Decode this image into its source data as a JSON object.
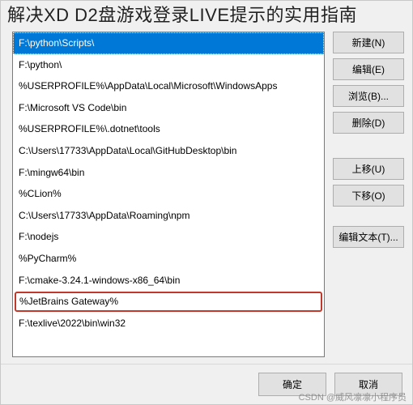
{
  "overlay_title": "解决XD D2盘游戏登录LIVE提示的实用指南",
  "path_list": {
    "selected_index": 0,
    "highlighted_index": 12,
    "items": [
      "F:\\python\\Scripts\\",
      "F:\\python\\",
      "%USERPROFILE%\\AppData\\Local\\Microsoft\\WindowsApps",
      "F:\\Microsoft VS Code\\bin",
      "%USERPROFILE%\\.dotnet\\tools",
      "C:\\Users\\17733\\AppData\\Local\\GitHubDesktop\\bin",
      "F:\\mingw64\\bin",
      "%CLion%",
      "C:\\Users\\17733\\AppData\\Roaming\\npm",
      "F:\\nodejs",
      "%PyCharm%",
      "F:\\cmake-3.24.1-windows-x86_64\\bin",
      "%JetBrains Gateway%",
      "F:\\texlive\\2022\\bin\\win32"
    ]
  },
  "side_buttons": {
    "new": "新建(N)",
    "edit": "编辑(E)",
    "browse": "浏览(B)...",
    "delete": "删除(D)",
    "move_up": "上移(U)",
    "move_down": "下移(O)",
    "edit_text": "编辑文本(T)..."
  },
  "footer_buttons": {
    "ok": "确定",
    "cancel": "取消"
  },
  "watermark": "CSDN @威风凛凛小程序员"
}
